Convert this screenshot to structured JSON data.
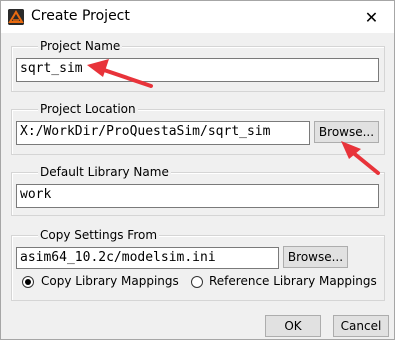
{
  "window": {
    "title": "Create Project",
    "close_glyph": "✕",
    "icon": "modelsim-logo-icon"
  },
  "project_name": {
    "label": "Project Name",
    "value": "sqrt_sim"
  },
  "project_location": {
    "label": "Project Location",
    "value": "X:/WorkDir/ProQuestaSim/sqrt_sim",
    "browse_label": "Browse..."
  },
  "default_library": {
    "label": "Default Library Name",
    "value": "work"
  },
  "copy_settings": {
    "label": "Copy Settings From",
    "value": "asim64_10.2c/modelsim.ini",
    "browse_label": "Browse...",
    "options": [
      {
        "label": "Copy Library Mappings",
        "selected": true
      },
      {
        "label": "Reference Library Mappings",
        "selected": false
      }
    ]
  },
  "buttons": {
    "ok": "OK",
    "cancel": "Cancel"
  },
  "colors": {
    "annotation_arrow": "#e8333a"
  }
}
